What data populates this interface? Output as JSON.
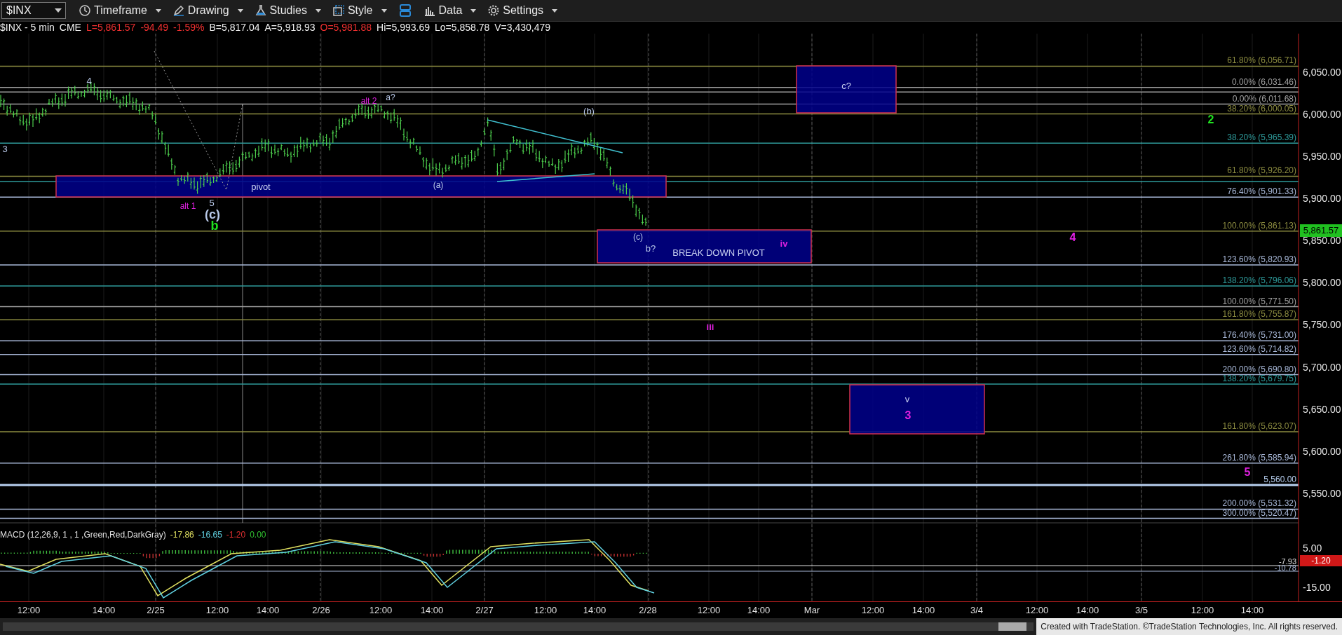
{
  "toolbar": {
    "symbol": "$INX",
    "buttons": [
      {
        "label": "Timeframe"
      },
      {
        "label": "Drawing"
      },
      {
        "label": "Studies"
      },
      {
        "label": "Style"
      },
      {
        "label": "Data"
      },
      {
        "label": "Settings"
      }
    ]
  },
  "quote": [
    {
      "text": "$INX - 5 min",
      "kind": "plain"
    },
    {
      "text": "CME",
      "kind": "plain"
    },
    {
      "text": "L=5,861.57",
      "kind": "down"
    },
    {
      "text": "-94.49",
      "kind": "down"
    },
    {
      "text": "-1.59%",
      "kind": "down"
    },
    {
      "text": "B=5,817.04",
      "kind": "plain"
    },
    {
      "text": "A=5,918.93",
      "kind": "plain"
    },
    {
      "text": "O=5,981.88",
      "kind": "down"
    },
    {
      "text": "Hi=5,993.69",
      "kind": "plain"
    },
    {
      "text": "Lo=5,858.78",
      "kind": "plain"
    },
    {
      "text": "V=3,430,479",
      "kind": "plain"
    }
  ],
  "fib_levels": [
    {
      "label": "61.80% (6,056.71)",
      "color": "#8c8c40"
    },
    {
      "label": "0.00% (6,031.46)",
      "color": "#a0a0a0"
    },
    {
      "label": "0.00% (6,011.68)",
      "color": "#a0a0a0"
    },
    {
      "label": "38.20% (6,000.05)",
      "color": "#8c8c40"
    },
    {
      "label": "38.20% (5,965.39)",
      "color": "#2e9a9a"
    },
    {
      "label": "61.80% (5,926.20)",
      "color": "#8c8c40"
    },
    {
      "label": "76.40% (5,901.33)",
      "color": "#a8b8d8"
    },
    {
      "label": "100.00% (5,861.13)",
      "color": "#8c8c40"
    },
    {
      "label": "123.60% (5,820.93)",
      "color": "#a8b8d8"
    },
    {
      "label": "138.20% (5,796.06)",
      "color": "#2e9a9a"
    },
    {
      "label": "100.00% (5,771.50)",
      "color": "#a0a0a0"
    },
    {
      "label": "161.80% (5,755.87)",
      "color": "#8c8c40"
    },
    {
      "label": "176.40% (5,731.00)",
      "color": "#a8b8d8"
    },
    {
      "label": "123.60% (5,714.82)",
      "color": "#a8b8d8"
    },
    {
      "label": "200.00% (5,690.80)",
      "color": "#a8b8d8"
    },
    {
      "label": "138.20% (5,679.75)",
      "color": "#2e9a9a"
    },
    {
      "label": "161.80% (5,623.07)",
      "color": "#8c8c40"
    },
    {
      "label": "261.80% (5,585.94)",
      "color": "#a8b8d8"
    },
    {
      "label": "5,560.00",
      "color": "#b8d0f0"
    },
    {
      "label": "200.00% (5,531.32)",
      "color": "#a8b8d8"
    },
    {
      "label": "300.00% (5,520.47)",
      "color": "#a8b8d8"
    }
  ],
  "zones": [
    {
      "label": "pivot"
    },
    {
      "label": "c?"
    },
    {
      "label": "BREAK DOWN PIVOT"
    },
    {
      "label": "v"
    }
  ],
  "wave_labels": [
    {
      "text": "4",
      "color": "#b8c8e8"
    },
    {
      "text": "3",
      "color": "#b8c8e8"
    },
    {
      "text": "alt 2",
      "color": "#e020e0"
    },
    {
      "text": "a?",
      "color": "#b8c8e8"
    },
    {
      "text": "alt 1",
      "color": "#e020e0"
    },
    {
      "text": "5",
      "color": "#b8c8e8"
    },
    {
      "text": "(c)",
      "color": "#b8c8e8"
    },
    {
      "text": "b",
      "color": "#20e020"
    },
    {
      "text": "(a)",
      "color": "#b8c8e8"
    },
    {
      "text": "(b)",
      "color": "#b8c8e8"
    },
    {
      "text": "(c)",
      "color": "#b8c8e8"
    },
    {
      "text": "b?",
      "color": "#b8c8e8"
    },
    {
      "text": "iv",
      "color": "#e020e0"
    },
    {
      "text": "iii",
      "color": "#e020e0"
    },
    {
      "text": "4",
      "color": "#e020e0"
    },
    {
      "text": "2",
      "color": "#20e020"
    },
    {
      "text": "3",
      "color": "#e020e0"
    },
    {
      "text": "5",
      "color": "#e020e0"
    }
  ],
  "price_axis": {
    "ticks": [
      "6,050.00",
      "6,000.00",
      "5,950.00",
      "5,900.00",
      "5,850.00",
      "5,800.00",
      "5,750.00",
      "5,700.00",
      "5,650.00",
      "5,600.00",
      "5,550.00"
    ],
    "last_price": "5,861.57"
  },
  "macd": {
    "title": "MACD (12,26,9, 1 , 1 ,Green,Red,DarkGray)",
    "values": [
      {
        "text": "-17.86",
        "color": "#e0e060"
      },
      {
        "text": "-16.65",
        "color": "#60d0e0"
      },
      {
        "text": "-1.20",
        "color": "#e03030"
      },
      {
        "text": "0.00",
        "color": "#30c030"
      }
    ],
    "ticks": [
      "5.00",
      "-15.00"
    ],
    "tag": "-1.20",
    "line_labels": [
      "-7.93",
      "-10.78"
    ]
  },
  "time_axis": [
    "12:00",
    "14:00",
    "2/25",
    "12:00",
    "14:00",
    "2/26",
    "12:00",
    "14:00",
    "2/27",
    "12:00",
    "14:00",
    "2/28",
    "12:00",
    "14:00",
    "Mar",
    "12:00",
    "14:00",
    "3/4",
    "12:00",
    "14:00",
    "3/5",
    "12:00",
    "14:00"
  ],
  "footer": "Created with TradeStation. ©TradeStation Technologies, Inc. All rights reserved."
}
